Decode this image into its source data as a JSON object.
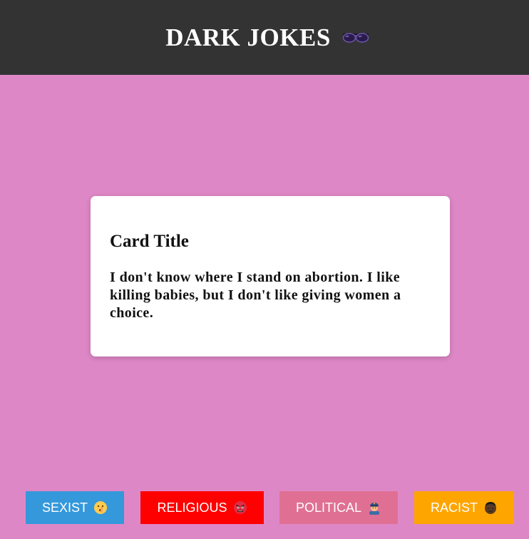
{
  "header": {
    "title": "DARK JOKES",
    "icon": "sunglasses-icon"
  },
  "card": {
    "title": "Card Title",
    "text": "I don't know where I stand on abortion. I like killing babies, but I don't like giving women a choice."
  },
  "buttons": [
    {
      "label": "SEXIST",
      "icon": "shushing-face-icon",
      "color": "#3498db"
    },
    {
      "label": "RELIGIOUS",
      "icon": "angry-face-icon",
      "color": "#ff0000"
    },
    {
      "label": "POLITICAL",
      "icon": "police-officer-icon",
      "color": "#e07093"
    },
    {
      "label": "RACIST",
      "icon": "dark-face-icon",
      "color": "#ffa500"
    }
  ],
  "colors": {
    "background": "#de87c6",
    "header": "#333333",
    "card": "#ffffff"
  }
}
